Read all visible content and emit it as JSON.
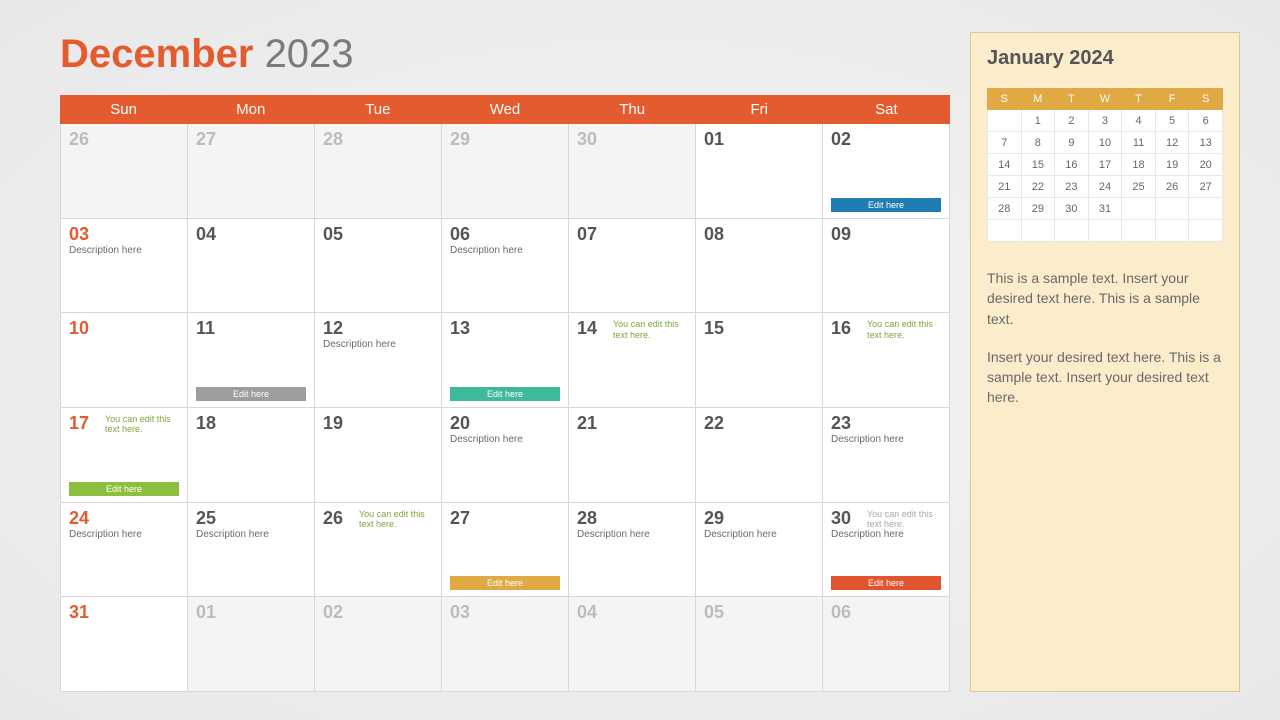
{
  "title": {
    "month": "December",
    "year": "2023"
  },
  "colors": {
    "accent": "#e35b2e",
    "bar_blue": "#1f7db3",
    "bar_grey": "#9d9d9d",
    "bar_teal": "#3fb99c",
    "bar_green": "#8cbf3f",
    "bar_gold": "#e0a944",
    "bar_red": "#e0542e"
  },
  "dayHeaders": [
    "Sun",
    "Mon",
    "Tue",
    "Wed",
    "Thu",
    "Fri",
    "Sat"
  ],
  "editLabel": "Edit here",
  "descLabel": "Description here",
  "noteLabel": "You can edit this text here.",
  "cells": [
    {
      "n": "26",
      "out": true
    },
    {
      "n": "27",
      "out": true
    },
    {
      "n": "28",
      "out": true
    },
    {
      "n": "29",
      "out": true
    },
    {
      "n": "30",
      "out": true
    },
    {
      "n": "01"
    },
    {
      "n": "02",
      "bar": "bar_blue"
    },
    {
      "n": "03",
      "sun": true,
      "desc": true
    },
    {
      "n": "04"
    },
    {
      "n": "05"
    },
    {
      "n": "06",
      "desc": true
    },
    {
      "n": "07"
    },
    {
      "n": "08"
    },
    {
      "n": "09"
    },
    {
      "n": "10",
      "sun": true
    },
    {
      "n": "11",
      "bar": "bar_grey"
    },
    {
      "n": "12",
      "desc": true
    },
    {
      "n": "13",
      "bar": "bar_teal"
    },
    {
      "n": "14",
      "note": true
    },
    {
      "n": "15"
    },
    {
      "n": "16",
      "note": true
    },
    {
      "n": "17",
      "sun": true,
      "note": true,
      "bar": "bar_green"
    },
    {
      "n": "18"
    },
    {
      "n": "19"
    },
    {
      "n": "20",
      "desc": true
    },
    {
      "n": "21"
    },
    {
      "n": "22"
    },
    {
      "n": "23",
      "desc": true
    },
    {
      "n": "24",
      "sun": true,
      "desc": true
    },
    {
      "n": "25",
      "desc": true
    },
    {
      "n": "26",
      "note": true
    },
    {
      "n": "27",
      "bar": "bar_gold"
    },
    {
      "n": "28",
      "desc": true
    },
    {
      "n": "29",
      "desc": true
    },
    {
      "n": "30",
      "desc": true,
      "note": true,
      "noteGrey": true,
      "bar": "bar_red"
    },
    {
      "n": "31",
      "sun": true
    },
    {
      "n": "01",
      "out": true
    },
    {
      "n": "02",
      "out": true
    },
    {
      "n": "03",
      "out": true
    },
    {
      "n": "04",
      "out": true
    },
    {
      "n": "05",
      "out": true
    },
    {
      "n": "06",
      "out": true
    }
  ],
  "side": {
    "title": "January 2024",
    "miniHeaders": [
      "S",
      "M",
      "T",
      "W",
      "T",
      "F",
      "S"
    ],
    "miniRows": [
      [
        "",
        "1",
        "2",
        "3",
        "4",
        "5",
        "6"
      ],
      [
        "7",
        "8",
        "9",
        "10",
        "11",
        "12",
        "13"
      ],
      [
        "14",
        "15",
        "16",
        "17",
        "18",
        "19",
        "20"
      ],
      [
        "21",
        "22",
        "23",
        "24",
        "25",
        "26",
        "27"
      ],
      [
        "28",
        "29",
        "30",
        "31",
        "",
        "",
        ""
      ],
      [
        "",
        "",
        "",
        "",
        "",
        "",
        ""
      ]
    ],
    "para1": "This is a sample text. Insert your desired text here. This is a sample text.",
    "para2": "Insert your desired text here. This is a sample text. Insert your desired text here."
  }
}
